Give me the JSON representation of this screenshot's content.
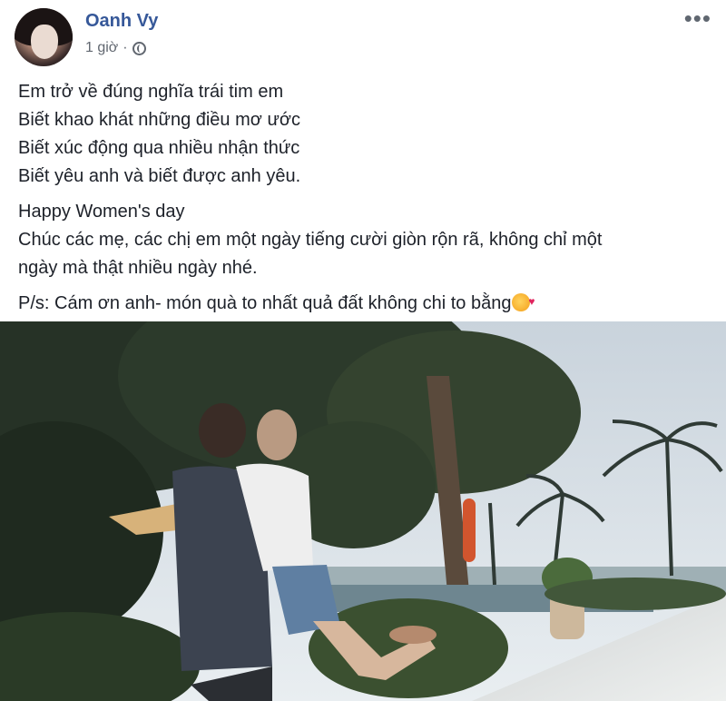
{
  "post": {
    "author": "Oanh Vy",
    "timestamp": "1 giờ",
    "separator": "·",
    "privacy_icon": "globe-icon",
    "more_icon": "more-options-icon",
    "paragraphs": [
      [
        "Em trở về đúng nghĩa trái tim em",
        "Biết khao khát những điều mơ ước",
        "Biết xúc động qua nhiều nhận thức",
        "Biết yêu anh và biết được anh yêu."
      ],
      [
        "Happy Women's day",
        "Chúc các mẹ, các chị em một ngày tiếng cười giòn rộn rã, không chỉ một",
        "ngày mà thật nhiều ngày nhé."
      ],
      [
        "P/s: Cám ơn anh- món quà to nhất quả đất không chi to bằng"
      ]
    ],
    "emoji_icon": "smiling-face-with-hearts-icon"
  },
  "colors": {
    "author_link": "#365899",
    "meta_text": "#616770",
    "body_text": "#1d2129"
  }
}
